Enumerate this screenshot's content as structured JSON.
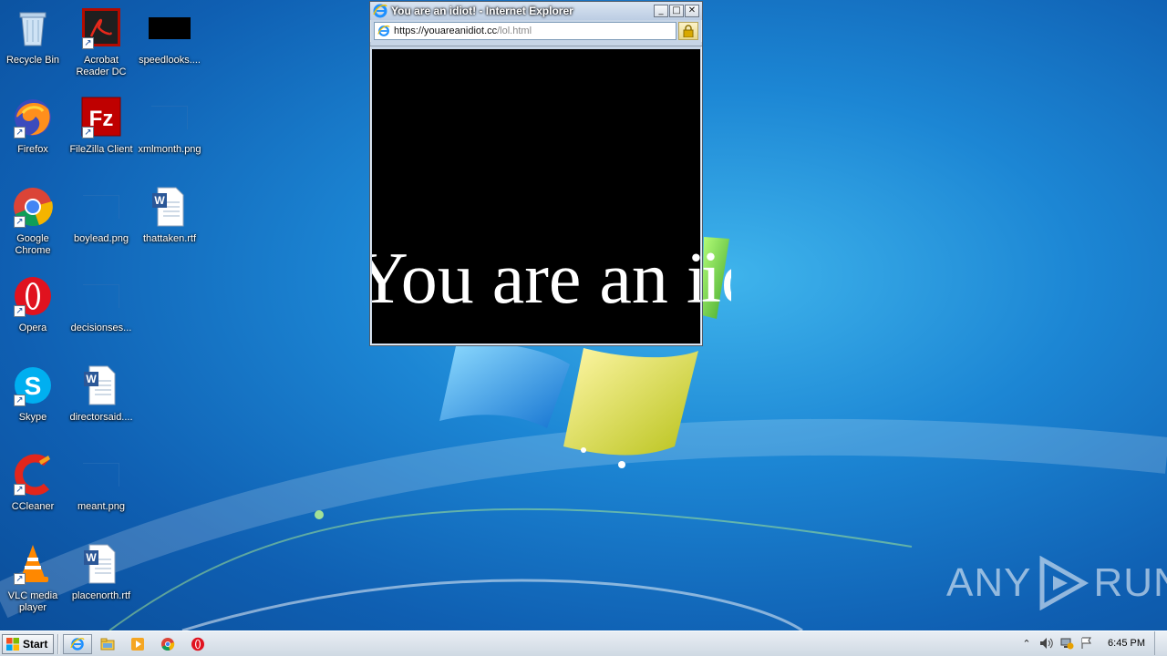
{
  "desktop": {
    "icons": [
      {
        "label": "Recycle Bin",
        "icon": "recycle-bin-icon"
      },
      {
        "label": "Acrobat Reader DC",
        "icon": "acrobat-icon"
      },
      {
        "label": "speedlooks....",
        "icon": "image-file-icon"
      },
      {
        "label": "Firefox",
        "icon": "firefox-icon"
      },
      {
        "label": "FileZilla Client",
        "icon": "filezilla-icon"
      },
      {
        "label": "xmlmonth.png",
        "icon": "image-file-icon"
      },
      {
        "label": "Google Chrome",
        "icon": "chrome-icon"
      },
      {
        "label": "boylead.png",
        "icon": "image-file-icon"
      },
      {
        "label": "thattaken.rtf",
        "icon": "word-document-icon"
      },
      {
        "label": "Opera",
        "icon": "opera-icon"
      },
      {
        "label": "decisionses...",
        "icon": "image-file-icon"
      },
      {
        "label": "Skype",
        "icon": "skype-icon"
      },
      {
        "label": "directorsaid....",
        "icon": "word-document-icon"
      },
      {
        "label": "CCleaner",
        "icon": "ccleaner-icon"
      },
      {
        "label": "meant.png",
        "icon": "image-file-icon"
      },
      {
        "label": "VLC media player",
        "icon": "vlc-icon"
      },
      {
        "label": "placenorth.rtf",
        "icon": "word-document-icon"
      }
    ]
  },
  "ie_window": {
    "title": "You are an idiot! - Internet Explorer",
    "url_host": "https://youareanidiot.cc",
    "url_path": "/lol.html",
    "content_text": "You are an idiot!",
    "buttons": {
      "minimize": "_",
      "maximize": "□",
      "close": "✕"
    }
  },
  "watermark": {
    "left": "ANY",
    "right": "RUN"
  },
  "taskbar": {
    "start_label": "Start",
    "items": [
      "internet-explorer-icon",
      "explorer-folder-icon",
      "media-player-icon",
      "chrome-icon",
      "opera-icon"
    ],
    "clock": "6:45 PM"
  }
}
